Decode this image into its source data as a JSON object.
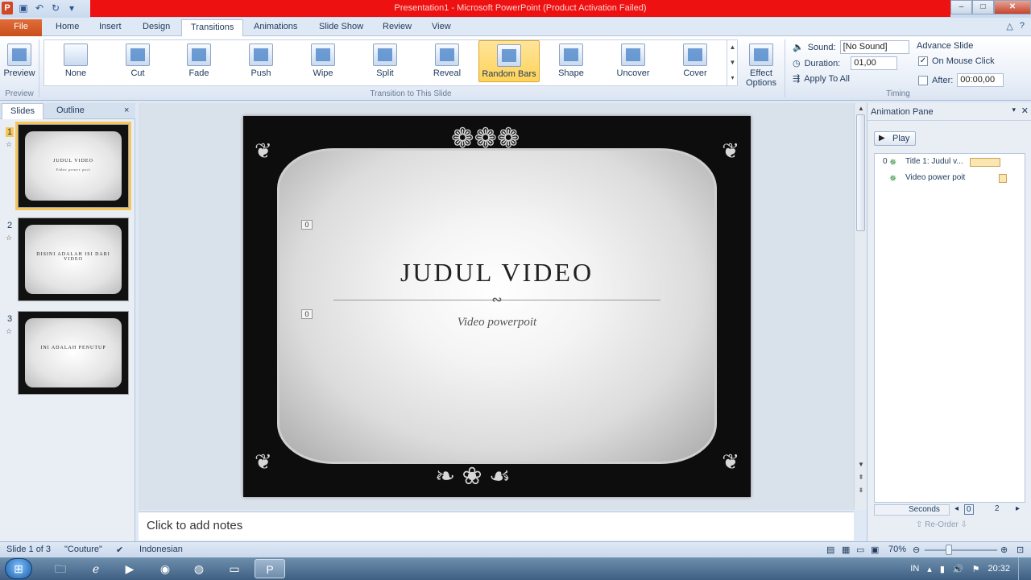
{
  "window": {
    "title": "Presentation1  -  Microsoft PowerPoint (Product Activation Failed)",
    "app_icon": "P"
  },
  "tabs": [
    "File",
    "Home",
    "Insert",
    "Design",
    "Transitions",
    "Animations",
    "Slide Show",
    "Review",
    "View"
  ],
  "ribbon": {
    "preview_label": "Preview",
    "preview_group": "Preview",
    "transitions": [
      "None",
      "Cut",
      "Fade",
      "Push",
      "Wipe",
      "Split",
      "Reveal",
      "Random Bars",
      "Shape",
      "Uncover",
      "Cover"
    ],
    "selected_transition": "Random Bars",
    "effect_options_label": "Effect\nOptions",
    "transition_group": "Transition to This Slide",
    "timing": {
      "sound_label": "Sound:",
      "sound_value": "[No Sound]",
      "duration_label": "Duration:",
      "duration_value": "01,00",
      "apply_all_label": "Apply To All",
      "advance_label": "Advance Slide",
      "on_mouse_click_label": "On Mouse Click",
      "on_mouse_click_checked": true,
      "after_label": "After:",
      "after_value": "00:00,00",
      "after_checked": false,
      "group_label": "Timing"
    }
  },
  "slides_panel": {
    "tab_slides": "Slides",
    "tab_outline": "Outline",
    "close": "×",
    "slides": [
      {
        "num": "1",
        "title": "JUDUL VIDEO",
        "subtitle": "Video power poit"
      },
      {
        "num": "2",
        "title": "DISINI ADALAH ISI DARI VIDEO",
        "subtitle": ""
      },
      {
        "num": "3",
        "title": "INI ADALAH PENUTUP",
        "subtitle": ""
      }
    ]
  },
  "slide": {
    "title": "JUDUL VIDEO",
    "subtitle": "Video powerpoit",
    "anim_tag_1": "0",
    "anim_tag_2": "0"
  },
  "notes": {
    "placeholder": "Click to add notes"
  },
  "animation_pane": {
    "title": "Animation Pane",
    "play_label": "Play",
    "items": [
      {
        "index": "0",
        "label": "Title 1: Judul v..."
      },
      {
        "index": "",
        "label": "Video power poit"
      }
    ],
    "seconds_label": "Seconds",
    "timeline_start": "0",
    "timeline_mark": "2",
    "reorder_label": "Re-Order"
  },
  "status": {
    "slide_info": "Slide 1 of 3",
    "theme": "\"Couture\"",
    "language": "Indonesian",
    "zoom": "70%"
  },
  "taskbar": {
    "lang": "IN",
    "time": "20:32"
  }
}
